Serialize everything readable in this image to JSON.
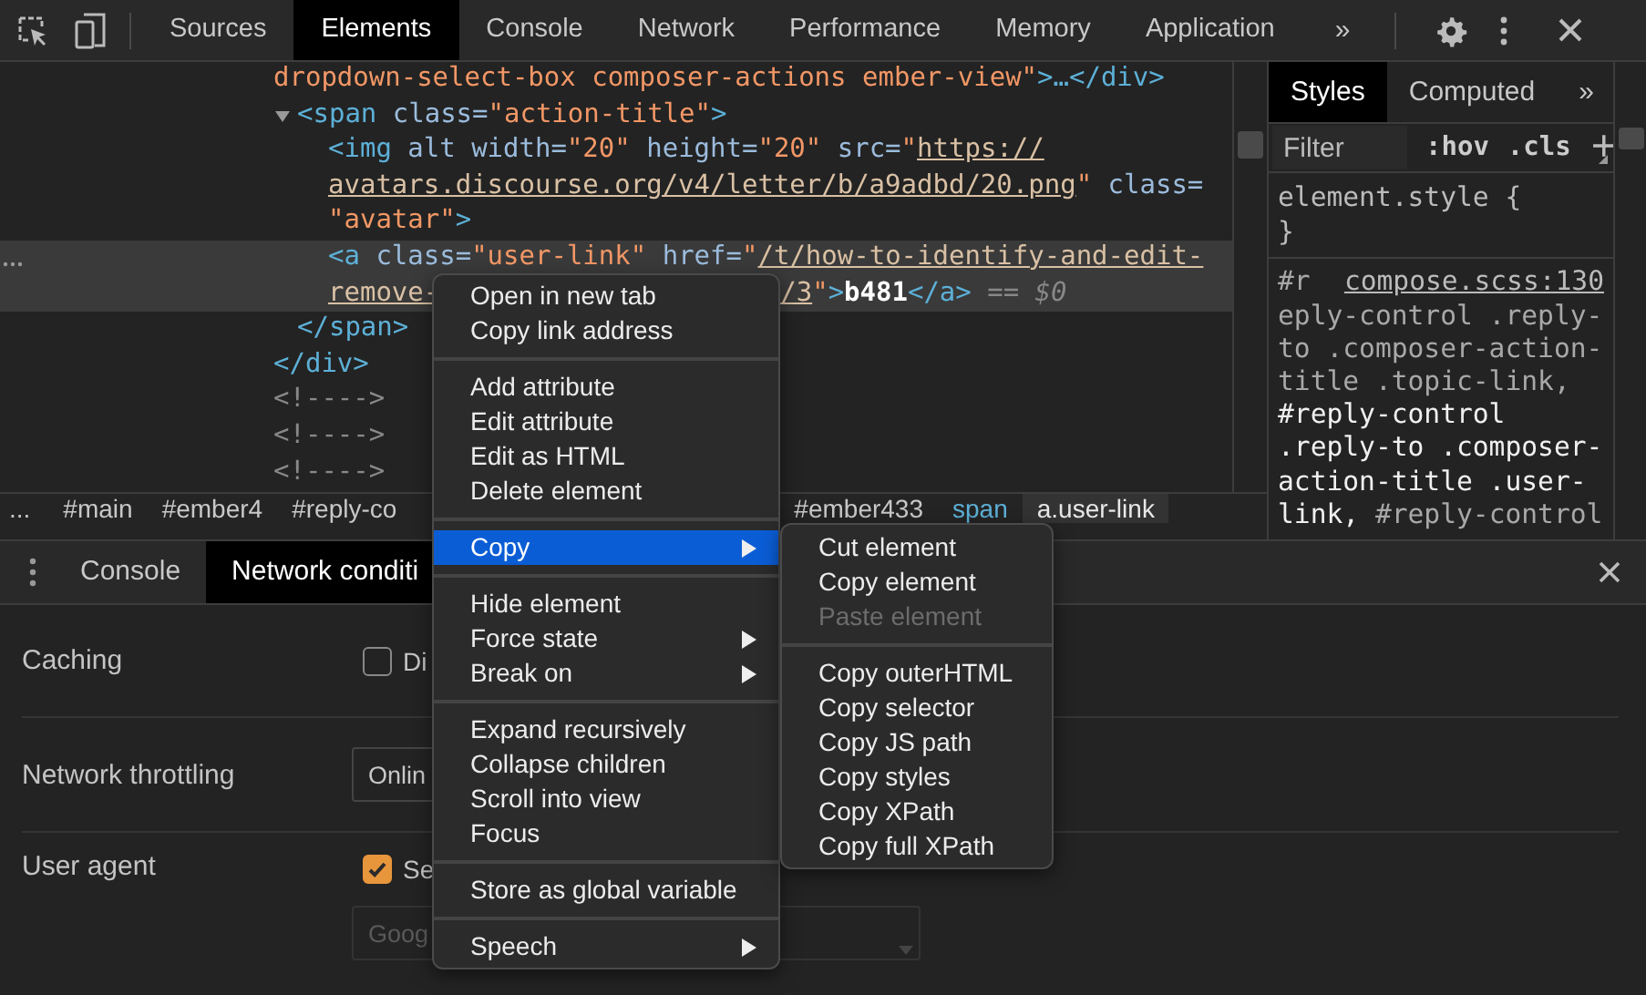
{
  "toolbar": {
    "tabs": [
      {
        "label": "Sources",
        "selected": false
      },
      {
        "label": "Elements",
        "selected": true
      },
      {
        "label": "Console",
        "selected": false
      },
      {
        "label": "Network",
        "selected": false
      },
      {
        "label": "Performance",
        "selected": false
      },
      {
        "label": "Memory",
        "selected": false
      },
      {
        "label": "Application",
        "selected": false
      }
    ],
    "overflow": "»"
  },
  "elements": {
    "tree": [
      {
        "selected": false,
        "lines": [
          [
            [
              {
                "text": "dropdown-select-box composer-actions ember-view\"",
                "kind": "value"
              },
              {
                "text": ">…</div>",
                "kind": "tag"
              }
            ]
          ]
        ]
      },
      {
        "selected": false,
        "expanded": true,
        "lines": [
          [
            [
              {
                "text": "<span",
                "kind": "tag"
              },
              {
                "text": " class=",
                "kind": "attr"
              },
              {
                "text": "\"action-title\"",
                "kind": "value"
              },
              {
                "text": ">",
                "kind": "tag"
              }
            ]
          ]
        ],
        "children": [
          {
            "selected": false,
            "lines": [
              [
                [
                  {
                    "text": "<img",
                    "kind": "tag"
                  },
                  {
                    "text": " alt width=",
                    "kind": "attr"
                  },
                  {
                    "text": "\"20\"",
                    "kind": "value"
                  },
                  {
                    "text": " height=",
                    "kind": "attr"
                  },
                  {
                    "text": "\"20\"",
                    "kind": "value"
                  },
                  {
                    "text": " src=",
                    "kind": "attr"
                  },
                  {
                    "text": "\"",
                    "kind": "value"
                  },
                  {
                    "text": "https://",
                    "kind": "link"
                  }
                ]
              ],
              [
                [
                  {
                    "text": "avatars.discourse.org/v4/letter/b/a9adbd/20.png",
                    "kind": "link"
                  },
                  {
                    "text": "\"",
                    "kind": "value"
                  },
                  {
                    "text": " class=",
                    "kind": "attr"
                  }
                ]
              ],
              [
                [
                  {
                    "text": "\"avatar\"",
                    "kind": "value"
                  },
                  {
                    "text": ">",
                    "kind": "tag"
                  }
                ]
              ]
            ]
          },
          {
            "selected": true,
            "lines": [
              [
                [
                  {
                    "text": "<a",
                    "kind": "tag"
                  },
                  {
                    "text": " class=",
                    "kind": "attr"
                  },
                  {
                    "text": "\"user-link\"",
                    "kind": "value"
                  },
                  {
                    "text": " href=",
                    "kind": "attr"
                  },
                  {
                    "text": "\"",
                    "kind": "value"
                  },
                  {
                    "text": "/t/how-to-identify-and-edit-",
                    "kind": "link"
                  }
                ]
              ],
              [
                [
                  {
                    "text": "remove-",
                    "kind": "link"
                  }
                ],
                [
                  {
                    "text": "/3",
                    "kind": "link"
                  },
                  {
                    "text": "\"",
                    "kind": "value"
                  },
                  {
                    "text": ">",
                    "kind": "tag"
                  },
                  {
                    "text": "b481",
                    "kind": "text"
                  },
                  {
                    "text": "</a>",
                    "kind": "tag"
                  },
                  {
                    "text": " == $0",
                    "kind": "eq"
                  }
                ]
              ]
            ]
          }
        ],
        "close": [
          [
            [
              {
                "text": "</span>",
                "kind": "tag"
              }
            ]
          ]
        ]
      },
      {
        "selected": false,
        "lines": [
          [
            [
              {
                "text": "</div>",
                "kind": "tag"
              }
            ]
          ]
        ]
      },
      {
        "selected": false,
        "lines": [
          [
            [
              {
                "text": "<!---->",
                "kind": "comment"
              }
            ]
          ]
        ]
      },
      {
        "selected": false,
        "lines": [
          [
            [
              {
                "text": "<!---->",
                "kind": "comment"
              }
            ]
          ]
        ]
      },
      {
        "selected": false,
        "lines": [
          [
            [
              {
                "text": "<!---->",
                "kind": "comment"
              }
            ]
          ]
        ]
      }
    ],
    "breadcrumbs": [
      {
        "label": "...",
        "kind": "more",
        "selected": false
      },
      {
        "label": "#main",
        "kind": "id",
        "selected": false
      },
      {
        "label": "#ember4",
        "kind": "id",
        "selected": false
      },
      {
        "label": "#reply-co",
        "kind": "id",
        "selected": false
      },
      {
        "label": "#ember433",
        "kind": "id",
        "selected": false
      },
      {
        "label": "span",
        "kind": "tag",
        "selected": false
      },
      {
        "label": "a.user-link",
        "kind": "class",
        "selected": true
      }
    ]
  },
  "styles": {
    "tabs": [
      {
        "label": "Styles",
        "selected": true
      },
      {
        "label": "Computed",
        "selected": false
      }
    ],
    "overflow": "»",
    "filter": {
      "placeholder": "Filter"
    },
    "toggles": [
      ":hov",
      ".cls"
    ],
    "add": "+",
    "element_style": [
      "element.style {",
      "}"
    ],
    "rule": {
      "head": "#r",
      "source": "compose.scss:130",
      "lines": [
        [
          {
            "text": "eply-control .reply-",
            "matched": false
          }
        ],
        [
          {
            "text": "to .composer-action-",
            "matched": false
          }
        ],
        [
          {
            "text": "title .topic-link,",
            "matched": false
          }
        ],
        [
          {
            "text": "#reply-control",
            "matched": true
          }
        ],
        [
          {
            "text": ".reply-to .composer-",
            "matched": true
          }
        ],
        [
          {
            "text": "action-title .user-",
            "matched": true
          }
        ],
        [
          {
            "text": "link,",
            "matched": true
          },
          {
            "text": " #reply-control",
            "matched": false
          }
        ]
      ]
    }
  },
  "drawer": {
    "tabs": [
      {
        "label": "Console",
        "selected": false
      },
      {
        "label": "Network conditi",
        "selected": true
      }
    ],
    "settings": [
      {
        "kind": "checkbox",
        "label": "Caching",
        "checkbox": {
          "checked": false,
          "text": "Di"
        }
      },
      {
        "kind": "select",
        "label": "Network throttling",
        "select": {
          "value": "Onlin",
          "disabled": false
        }
      },
      {
        "kind": "checkbox-select",
        "label": "User agent",
        "checkbox": {
          "checked": true,
          "text": "Se"
        },
        "select": {
          "value": "Goog",
          "disabled": true
        }
      }
    ]
  },
  "context_menu": {
    "groups": [
      [
        {
          "label": "Open in new tab",
          "has_submenu": false,
          "selected": false
        },
        {
          "label": "Copy link address",
          "has_submenu": false,
          "selected": false
        }
      ],
      [
        {
          "label": "Add attribute",
          "has_submenu": false,
          "selected": false
        },
        {
          "label": "Edit attribute",
          "has_submenu": false,
          "selected": false
        },
        {
          "label": "Edit as HTML",
          "has_submenu": false,
          "selected": false
        },
        {
          "label": "Delete element",
          "has_submenu": false,
          "selected": false
        }
      ],
      [
        {
          "label": "Copy",
          "has_submenu": true,
          "selected": true
        }
      ],
      [
        {
          "label": "Hide element",
          "has_submenu": false,
          "selected": false
        },
        {
          "label": "Force state",
          "has_submenu": true,
          "selected": false
        },
        {
          "label": "Break on",
          "has_submenu": true,
          "selected": false
        }
      ],
      [
        {
          "label": "Expand recursively",
          "has_submenu": false,
          "selected": false
        },
        {
          "label": "Collapse children",
          "has_submenu": false,
          "selected": false
        },
        {
          "label": "Scroll into view",
          "has_submenu": false,
          "selected": false
        },
        {
          "label": "Focus",
          "has_submenu": false,
          "selected": false
        }
      ],
      [
        {
          "label": "Store as global variable",
          "has_submenu": false,
          "selected": false
        }
      ],
      [
        {
          "label": "Speech",
          "has_submenu": true,
          "selected": false
        }
      ]
    ]
  },
  "submenu": {
    "groups": [
      [
        {
          "label": "Cut element",
          "disabled": false
        },
        {
          "label": "Copy element",
          "disabled": false
        },
        {
          "label": "Paste element",
          "disabled": true
        }
      ],
      [
        {
          "label": "Copy outerHTML",
          "disabled": false
        },
        {
          "label": "Copy selector",
          "disabled": false
        },
        {
          "label": "Copy JS path",
          "disabled": false
        },
        {
          "label": "Copy styles",
          "disabled": false
        },
        {
          "label": "Copy XPath",
          "disabled": false
        },
        {
          "label": "Copy full XPath",
          "disabled": false
        }
      ]
    ]
  }
}
